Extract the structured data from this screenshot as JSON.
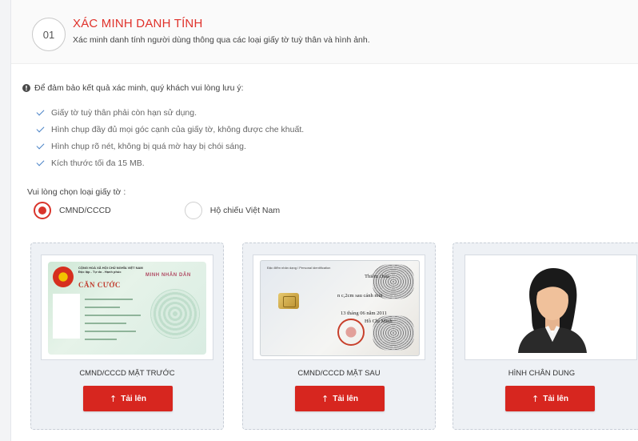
{
  "step": {
    "number": "01",
    "title": "XÁC MINH DANH TÍNH",
    "description": "Xác minh danh tính người dùng thông qua các loại giấy tờ tuỳ thân và hình ảnh."
  },
  "notice": {
    "text": "Để đảm bảo kết quả xác minh, quý khách vui lòng lưu ý:",
    "icon": "info-icon"
  },
  "requirements": [
    "Giấy tờ tuỳ thân phải còn hạn sử dụng.",
    "Hình chụp đầy đủ mọi góc cạnh của giấy tờ, không được che khuất.",
    "Hình chụp rõ nét, không bị quá mờ hay bị chói sáng.",
    "Kích thước tối đa 15 MB."
  ],
  "document_type": {
    "label": "Vui lòng chọn loại giấy tờ :",
    "options": [
      {
        "label": "CMND/CCCD",
        "selected": true
      },
      {
        "label": "Hộ chiếu Việt Nam",
        "selected": false
      }
    ]
  },
  "cards": [
    {
      "label": "CMND/CCCD MẶT TRƯỚC",
      "button": "Tải lên"
    },
    {
      "label": "CMND/CCCD MẶT SAU",
      "button": "Tải lên"
    },
    {
      "label": "HÌNH CHÂN DUNG",
      "button": "Tải lên"
    }
  ],
  "id_front": {
    "header_line1": "CỘNG HOÀ XÃ HỘI CHỦ NGHĨA VIỆT NAM",
    "header_line2": "Độc lập - Tự do - Hạnh phúc",
    "title": "CĂN CƯỚC",
    "title_right": "MINH NHÂN DÂN"
  },
  "id_back": {
    "header": "Đặc điểm nhân dạng / Personal identification",
    "line1": "Thiêm chúa",
    "line2": "n c,2cm sau cánh mũi",
    "line3": "13 tháng 06 năm 2011",
    "line4": "Hồ Chí Minh"
  },
  "colors": {
    "accent": "#d7261f",
    "title": "#e0322b",
    "check": "#4a83c7",
    "card_bg": "#eef1f5"
  }
}
